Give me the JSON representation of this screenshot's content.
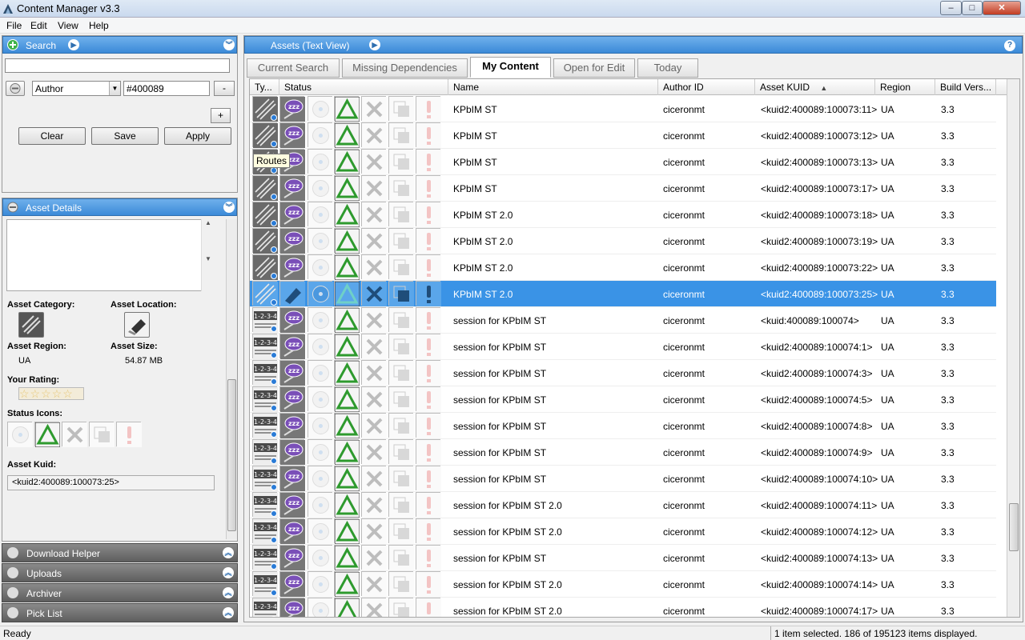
{
  "window": {
    "title": "Content Manager v3.3",
    "min": "–",
    "max": "□",
    "close": "✕"
  },
  "menu": [
    "File",
    "Edit",
    "View",
    "Help"
  ],
  "search_panel": {
    "title": "Search",
    "search_value": "",
    "criterion_field": "Author",
    "criterion_value": "#400089",
    "minus_label": "-",
    "plus_label": "+",
    "clear_label": "Clear",
    "save_label": "Save",
    "apply_label": "Apply"
  },
  "details_panel": {
    "title": "Asset Details",
    "category_label": "Asset Category:",
    "location_label": "Asset Location:",
    "region_label": "Asset Region:",
    "region_value": "UA",
    "size_label": "Asset Size:",
    "size_value": "54.87 MB",
    "rating_label": "Your Rating:",
    "rating_stars": "☆☆☆☆☆",
    "status_icons_label": "Status Icons:",
    "kuid_label": "Asset Kuid:",
    "kuid_value": "<kuid2:400089:100073:25>"
  },
  "collapsed_panels": [
    "Download Helper",
    "Uploads",
    "Archiver",
    "Pick List"
  ],
  "main_panel": {
    "title": "Assets (Text View)",
    "help": "?"
  },
  "tabs": [
    {
      "label": "Current Search",
      "active": false
    },
    {
      "label": "Missing Dependencies",
      "active": false
    },
    {
      "label": "My Content",
      "active": true
    },
    {
      "label": "Open for Edit",
      "active": false
    },
    {
      "label": "Today",
      "active": false
    }
  ],
  "columns": [
    "Ty...",
    "Status",
    "Name",
    "Author ID",
    "Asset KUID",
    "Region",
    "Build Vers..."
  ],
  "sort_indicator": "▲",
  "tooltip": "Routes",
  "rows": [
    {
      "type": "route",
      "name": "KPbIM ST",
      "author": "ciceronmt",
      "kuid": "<kuid2:400089:100073:11>",
      "region": "UA",
      "build": "3.3"
    },
    {
      "type": "route",
      "name": "KPbIM ST",
      "author": "ciceronmt",
      "kuid": "<kuid2:400089:100073:12>",
      "region": "UA",
      "build": "3.3"
    },
    {
      "type": "route",
      "name": "KPbIM ST",
      "author": "ciceronmt",
      "kuid": "<kuid2:400089:100073:13>",
      "region": "UA",
      "build": "3.3"
    },
    {
      "type": "route",
      "name": "KPbIM ST",
      "author": "ciceronmt",
      "kuid": "<kuid2:400089:100073:17>",
      "region": "UA",
      "build": "3.3"
    },
    {
      "type": "route",
      "name": "KPbIM ST 2.0",
      "author": "ciceronmt",
      "kuid": "<kuid2:400089:100073:18>",
      "region": "UA",
      "build": "3.3"
    },
    {
      "type": "route",
      "name": "KPbIM ST 2.0",
      "author": "ciceronmt",
      "kuid": "<kuid2:400089:100073:19>",
      "region": "UA",
      "build": "3.3"
    },
    {
      "type": "route",
      "name": "KPbIM ST 2.0",
      "author": "ciceronmt",
      "kuid": "<kuid2:400089:100073:22>",
      "region": "UA",
      "build": "3.3"
    },
    {
      "type": "route",
      "name": "KPbIM ST 2.0",
      "author": "ciceronmt",
      "kuid": "<kuid2:400089:100073:25>",
      "region": "UA",
      "build": "3.3",
      "selected": true
    },
    {
      "type": "session",
      "name": "session for KPbIM ST",
      "author": "ciceronmt",
      "kuid": "<kuid:400089:100074>",
      "region": "UA",
      "build": "3.3"
    },
    {
      "type": "session",
      "name": "session for KPbIM ST",
      "author": "ciceronmt",
      "kuid": "<kuid2:400089:100074:1>",
      "region": "UA",
      "build": "3.3"
    },
    {
      "type": "session",
      "name": "session for KPbIM ST",
      "author": "ciceronmt",
      "kuid": "<kuid2:400089:100074:3>",
      "region": "UA",
      "build": "3.3"
    },
    {
      "type": "session",
      "name": "session for KPbIM ST",
      "author": "ciceronmt",
      "kuid": "<kuid2:400089:100074:5>",
      "region": "UA",
      "build": "3.3"
    },
    {
      "type": "session",
      "name": "session for KPbIM ST",
      "author": "ciceronmt",
      "kuid": "<kuid2:400089:100074:8>",
      "region": "UA",
      "build": "3.3"
    },
    {
      "type": "session",
      "name": "session for KPbIM ST",
      "author": "ciceronmt",
      "kuid": "<kuid2:400089:100074:9>",
      "region": "UA",
      "build": "3.3"
    },
    {
      "type": "session",
      "name": "session for KPbIM ST",
      "author": "ciceronmt",
      "kuid": "<kuid2:400089:100074:10>",
      "region": "UA",
      "build": "3.3"
    },
    {
      "type": "session",
      "name": "session for KPbIM ST 2.0",
      "author": "ciceronmt",
      "kuid": "<kuid2:400089:100074:11>",
      "region": "UA",
      "build": "3.3"
    },
    {
      "type": "session",
      "name": "session for KPbIM ST 2.0",
      "author": "ciceronmt",
      "kuid": "<kuid2:400089:100074:12>",
      "region": "UA",
      "build": "3.3"
    },
    {
      "type": "session",
      "name": "session for KPbIM ST",
      "author": "ciceronmt",
      "kuid": "<kuid2:400089:100074:13>",
      "region": "UA",
      "build": "3.3"
    },
    {
      "type": "session",
      "name": "session for KPbIM ST 2.0",
      "author": "ciceronmt",
      "kuid": "<kuid2:400089:100074:14>",
      "region": "UA",
      "build": "3.3"
    },
    {
      "type": "session",
      "name": "session for KPbIM ST 2.0",
      "author": "ciceronmt",
      "kuid": "<kuid2:400089:100074:17>",
      "region": "UA",
      "build": "3.3"
    }
  ],
  "session_type_text": "1-2-3-4",
  "status_bar": {
    "left": "Ready",
    "right": "1 item selected. 186 of 195123 items displayed."
  },
  "colors": {
    "accent": "#3a93e6",
    "header_blue": "#4a96df",
    "status_green": "#2e9a2e",
    "zzz_purple": "#7a4fb8"
  }
}
